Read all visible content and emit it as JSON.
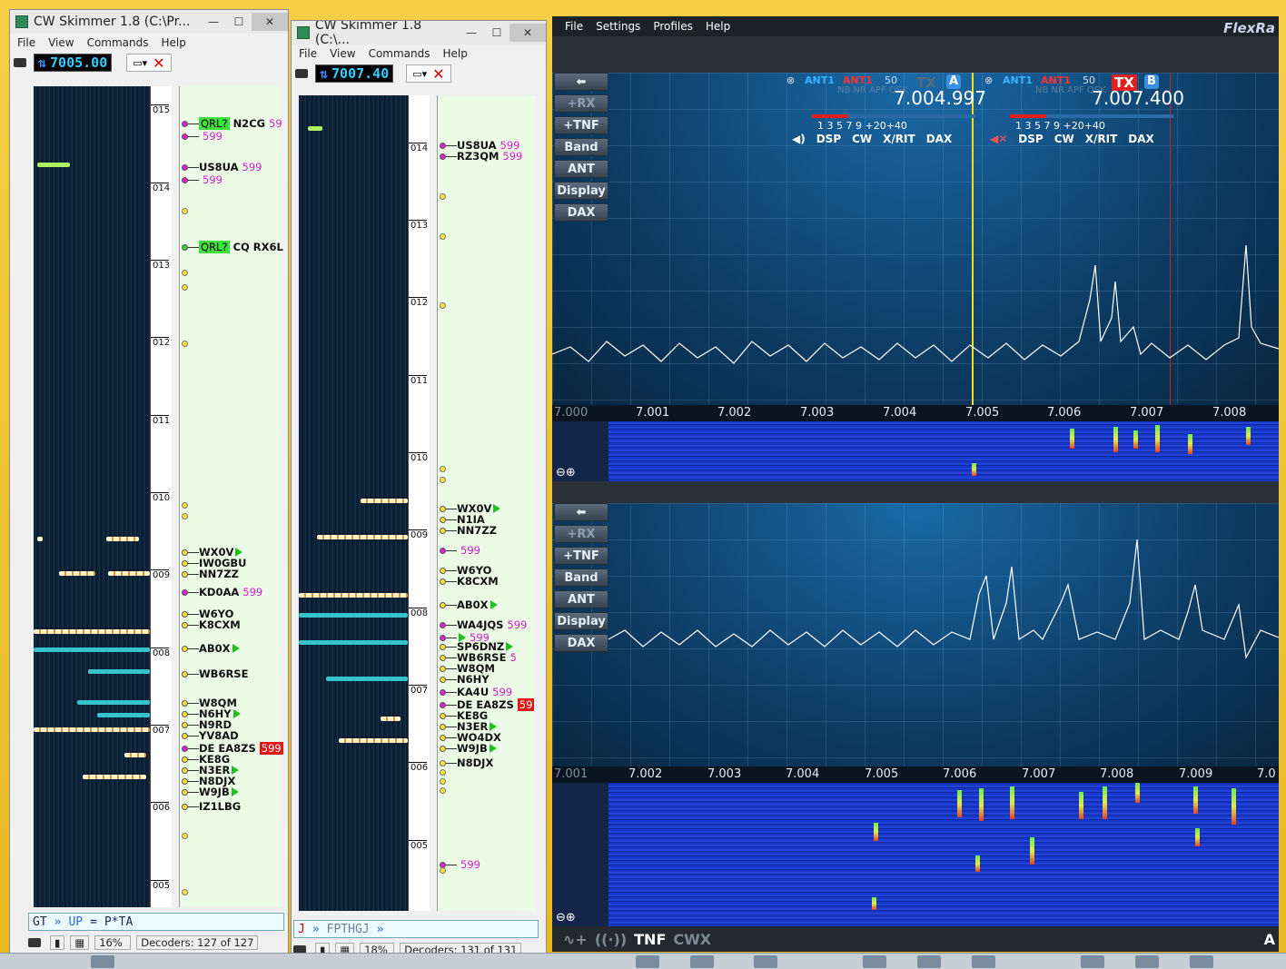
{
  "win1": {
    "title": "CW Skimmer 1.8 (C:\\Pr...",
    "menu": [
      "File",
      "View",
      "Commands",
      "Help"
    ],
    "freq": "7005.00",
    "scale": [
      "015",
      "014",
      "013",
      "012",
      "011",
      "010",
      "009",
      "008",
      "007",
      "006",
      "005"
    ],
    "spots": [
      {
        "tag": "QRL?",
        "call": "N2CG",
        "rst": "59",
        "dot": "m"
      },
      {
        "call": "",
        "rst": "599",
        "dot": "m"
      },
      {
        "call": "US8UA",
        "rst": "599",
        "dot": "m"
      },
      {
        "call": "",
        "rst": "599",
        "dot": "m"
      },
      {
        "tag": "QRL?",
        "call": "CQ RX6L",
        "rst": "",
        "dot": "g"
      },
      {
        "call": "WX0V",
        "tri": true,
        "dot": "y"
      },
      {
        "call": "IW0GBU",
        "dot": "y"
      },
      {
        "call": "NN7ZZ",
        "dot": "y"
      },
      {
        "call": "KD0AA",
        "rst": "599",
        "dot": "m"
      },
      {
        "call": "W6YO",
        "dot": "y"
      },
      {
        "call": "K8CXM",
        "dot": "y"
      },
      {
        "call": "AB0X",
        "tri": true,
        "dot": "y"
      },
      {
        "call": "WB6RSE",
        "dot": "y"
      },
      {
        "call": "W8QM",
        "dot": "y"
      },
      {
        "call": "N6HY",
        "tri": true,
        "dot": "y"
      },
      {
        "call": "N9RD",
        "dot": "y"
      },
      {
        "call": "YV8AD",
        "dot": "y"
      },
      {
        "call": "DE EA8ZS",
        "red": "599",
        "dot": "m"
      },
      {
        "call": "KE8G",
        "dot": "y"
      },
      {
        "call": "N3ER",
        "tri": true,
        "dot": "y"
      },
      {
        "call": "N8DJX",
        "dot": "y"
      },
      {
        "call": "W9JB",
        "tri": true,
        "dot": "y"
      },
      {
        "call": "IZ1LBG",
        "dot": "y"
      }
    ],
    "decode": {
      "a": "GT",
      "b": "UP",
      "c": "P*TA"
    },
    "status": {
      "pct": "16%",
      "decoders": "Decoders: 127 of 127"
    }
  },
  "win2": {
    "title": "CW Skimmer 1.8 (C:\\...",
    "menu": [
      "File",
      "View",
      "Commands",
      "Help"
    ],
    "freq": "7007.40",
    "scale": [
      "014",
      "013",
      "012",
      "011",
      "010",
      "009",
      "008",
      "007",
      "006",
      "005"
    ],
    "spots": [
      {
        "call": "US8UA",
        "rst": "599",
        "dot": "m"
      },
      {
        "call": "RZ3QM",
        "rst": "599",
        "dot": "m"
      },
      {
        "call": "WX0V",
        "tri": true,
        "dot": "y"
      },
      {
        "call": "N1IA",
        "dot": "y"
      },
      {
        "call": "NN7ZZ",
        "dot": "y"
      },
      {
        "call": "",
        "rst": "599",
        "dot": "m"
      },
      {
        "call": "W6YO",
        "dot": "y"
      },
      {
        "call": "K8CXM",
        "dot": "y"
      },
      {
        "call": "AB0X",
        "tri": true,
        "dot": "y"
      },
      {
        "call": "WA4JQS",
        "rst": "599",
        "dot": "m"
      },
      {
        "call": "",
        "rst": "599",
        "tri": true,
        "dot": "m"
      },
      {
        "call": "SP6DNZ",
        "tri": true,
        "dot": "y"
      },
      {
        "call": "WB6RSE",
        "rst": "5",
        "dot": "y"
      },
      {
        "call": "W8QM",
        "dot": "y"
      },
      {
        "call": "N6HY",
        "dot": "y"
      },
      {
        "call": "KA4U",
        "rst": "599",
        "dot": "m"
      },
      {
        "call": "DE EA8ZS",
        "red": "59",
        "dot": "m"
      },
      {
        "call": "KE8G",
        "dot": "y"
      },
      {
        "call": "N3ER",
        "tri": true,
        "dot": "y"
      },
      {
        "call": "WO4DX",
        "dot": "y"
      },
      {
        "call": "W9JB",
        "tri": true,
        "dot": "y"
      },
      {
        "call": "N8DJX",
        "dot": "y"
      },
      {
        "call": "",
        "rst": "599",
        "dot": "m"
      }
    ],
    "decode": {
      "a": "J",
      "b": "FPTHGJ"
    },
    "status": {
      "pct": "18%",
      "decoders": "Decoders: 131 of 131"
    }
  },
  "flex": {
    "menu": [
      "File",
      "Settings",
      "Profiles",
      "Help"
    ],
    "logo": "FlexRa",
    "buttons": [
      "+RX",
      "+TNF",
      "Band",
      "ANT",
      "Display",
      "DAX"
    ],
    "sliceA": {
      "ant": "ANT1",
      "ant2": "ANT1",
      "tx": "TX",
      "letter": "A",
      "freq": "7.004.997",
      "row": [
        "DSP",
        "CW",
        "X/RIT",
        "DAX"
      ],
      "scale": "1  3  5  7  9 +20+40",
      "mode": "NB NR APF QSK",
      "v": "50"
    },
    "sliceB": {
      "ant": "ANT1",
      "ant2": "ANT1",
      "tx": "TX",
      "letter": "B",
      "freq": "7.007.400",
      "row": [
        "DSP",
        "CW",
        "X/RIT",
        "DAX"
      ],
      "scale": "1  3  5  7  9 +20+40",
      "mode": "NB NR APF QSK",
      "v": "50"
    },
    "axis1": [
      "7.000",
      "7.001",
      "7.002",
      "7.003",
      "7.004",
      "7.005",
      "7.006",
      "7.007",
      "7.008"
    ],
    "axis2": [
      "7.001",
      "7.002",
      "7.003",
      "7.004",
      "7.005",
      "7.006",
      "7.007",
      "7.008",
      "7.009",
      "7.0"
    ],
    "bottom": {
      "tnf": "TNF",
      "cwx": "CWX",
      "right": "A"
    }
  }
}
